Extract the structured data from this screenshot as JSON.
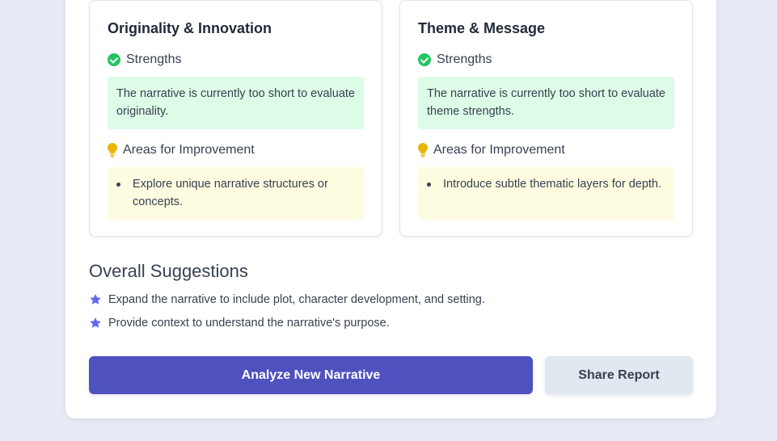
{
  "cards": [
    {
      "title": "Originality & Innovation",
      "strengths_label": "Strengths",
      "strengths_text": "The narrative is currently too short to evaluate originality.",
      "improvement_label": "Areas for Improvement",
      "improvements": [
        "Explore unique narrative structures or concepts."
      ]
    },
    {
      "title": "Theme & Message",
      "strengths_label": "Strengths",
      "strengths_text": "The narrative is currently too short to evaluate theme strengths.",
      "improvement_label": "Areas for Improvement",
      "improvements": [
        "Introduce subtle thematic layers for depth."
      ]
    }
  ],
  "overall": {
    "title": "Overall Suggestions",
    "items": [
      "Expand the narrative to include plot, character development, and setting.",
      "Provide context to understand the narrative's purpose."
    ]
  },
  "actions": {
    "analyze_label": "Analyze New Narrative",
    "share_label": "Share Report"
  },
  "colors": {
    "accent": "#4f51bf",
    "success": "#22c55e",
    "strengths_bg": "#dcfce7",
    "improvement_bg": "#fefce0",
    "star": "#6366f1",
    "bulb": "#eab308"
  },
  "icons": {
    "strengths": "check-circle-icon",
    "improvement": "lightbulb-icon",
    "suggestion": "star-icon"
  }
}
